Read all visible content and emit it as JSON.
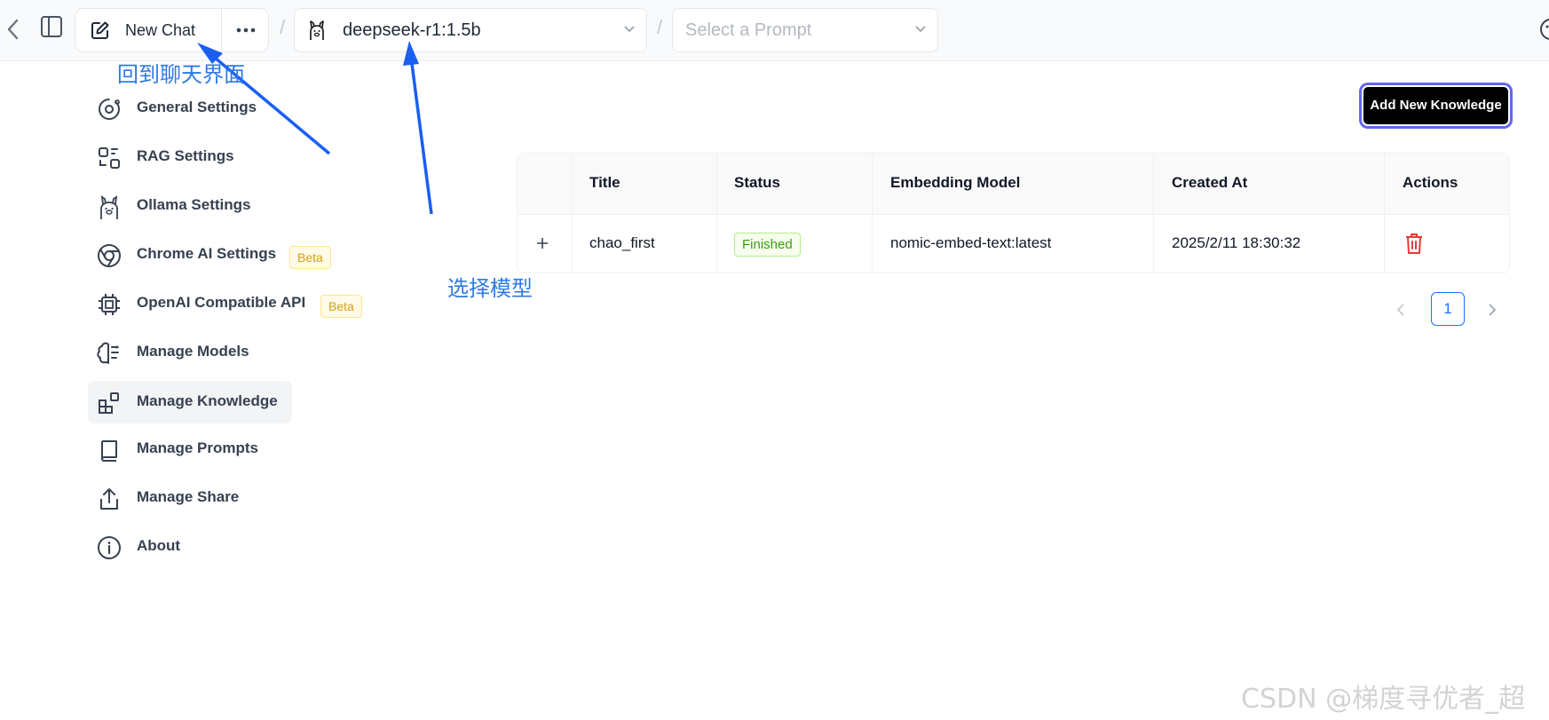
{
  "header": {
    "new_chat_label": "New Chat",
    "model_name": "deepseek-r1:1.5b",
    "prompt_placeholder": "Select a Prompt",
    "separator": "/"
  },
  "sidebar": {
    "items": [
      {
        "label": "General Settings",
        "icon": "settings-gear-icon"
      },
      {
        "label": "RAG Settings",
        "icon": "rag-icon"
      },
      {
        "label": "Ollama Settings",
        "icon": "ollama-llama-icon"
      },
      {
        "label": "Chrome AI Settings",
        "icon": "chrome-icon",
        "badge": "Beta"
      },
      {
        "label": "OpenAI Compatible API",
        "icon": "cpu-chip-icon",
        "badge": "Beta"
      },
      {
        "label": "Manage Models",
        "icon": "brain-icon"
      },
      {
        "label": "Manage Knowledge",
        "icon": "blocks-icon",
        "active": true
      },
      {
        "label": "Manage Prompts",
        "icon": "book-icon"
      },
      {
        "label": "Manage Share",
        "icon": "share-icon"
      },
      {
        "label": "About",
        "icon": "info-icon"
      }
    ]
  },
  "main": {
    "add_button_label": "Add New Knowledge",
    "table": {
      "columns": [
        "",
        "Title",
        "Status",
        "Embedding Model",
        "Created At",
        "Actions"
      ],
      "rows": [
        {
          "title": "chao_first",
          "status": "Finished",
          "embedding_model": "nomic-embed-text:latest",
          "created_at": "2025/2/11 18:30:32"
        }
      ]
    },
    "pagination": {
      "current_page": "1"
    }
  },
  "annotations": {
    "back_to_chat": "回到聊天界面",
    "select_model": "选择模型"
  },
  "watermark": "CSDN @梯度寻优者_超",
  "colors": {
    "accent": "#1677ff",
    "annotation": "#2f7ae5",
    "danger": "#e53935",
    "success": "#389e0d"
  }
}
